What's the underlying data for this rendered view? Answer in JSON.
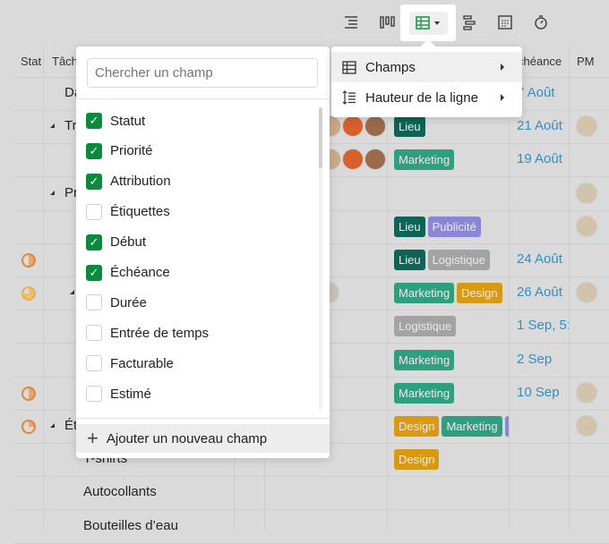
{
  "toolbar": {
    "icons": [
      "list-icon",
      "board-icon",
      "table-icon",
      "gantt-icon",
      "calendar-icon",
      "timer-icon"
    ],
    "active": "table-icon"
  },
  "table": {
    "headers": {
      "status": "Stat",
      "task": "Tâch",
      "due": "chéance",
      "pm": "PM"
    },
    "rows": [
      {
        "task": "Da",
        "due": "7 Août",
        "tags": []
      },
      {
        "task": "Tr",
        "due": "21 Août",
        "tags": [
          "Lieu"
        ],
        "caret": true,
        "pm": true,
        "assignees": true
      },
      {
        "task": "",
        "due": "19 Août",
        "tags": [
          "Marketing"
        ],
        "assignees": true
      },
      {
        "task": "Pr",
        "due": "",
        "tags": [],
        "caret": true,
        "pm": true
      },
      {
        "task": "",
        "due": "",
        "tags": [
          "Lieu",
          "Publicité"
        ],
        "pm": true
      },
      {
        "task": "",
        "due": "24 Août",
        "tags": [
          "Lieu",
          "Logistique"
        ],
        "status": "half"
      },
      {
        "task": "",
        "due": "26 Août",
        "tags": [
          "Marketing",
          "Design"
        ],
        "status": "quarter-yellow",
        "caret": true,
        "pm": true
      },
      {
        "task": "",
        "due": "1 Sep, 5:",
        "tags": [
          "Logistique"
        ]
      },
      {
        "task": "",
        "due": "2 Sep",
        "tags": [
          "Marketing"
        ]
      },
      {
        "task": "",
        "due": "10 Sep",
        "tags": [
          "Marketing"
        ],
        "status": "half",
        "pm": true
      },
      {
        "task": "Ét",
        "due": "",
        "tags": [
          "Design",
          "Marketing",
          "Publicité"
        ],
        "status": "quarter",
        "caret": true,
        "pm": true
      },
      {
        "task": "T-shirts",
        "due": "",
        "tags": [
          "Design"
        ]
      },
      {
        "task": "Autocollants",
        "due": "",
        "tags": []
      },
      {
        "task": "Bouteilles d’eau",
        "due": "",
        "tags": []
      }
    ],
    "tag_colors": {
      "Lieu": "#0d6456",
      "Marketing": "#2f9f80",
      "Design": "#d99a12",
      "Publicité": "#8c86d6",
      "Logistique": "#a3a3a3"
    }
  },
  "fields_panel": {
    "search_placeholder": "Chercher un champ",
    "fields": [
      {
        "label": "Statut",
        "checked": true
      },
      {
        "label": "Priorité",
        "checked": true
      },
      {
        "label": "Attribution",
        "checked": true
      },
      {
        "label": "Étiquettes",
        "checked": false
      },
      {
        "label": "Début",
        "checked": true
      },
      {
        "label": "Échéance",
        "checked": true
      },
      {
        "label": "Durée",
        "checked": false
      },
      {
        "label": "Entrée de temps",
        "checked": false
      },
      {
        "label": "Facturable",
        "checked": false
      },
      {
        "label": "Estimé",
        "checked": false
      }
    ],
    "add_label": "Ajouter un nouveau champ"
  },
  "view_menu": {
    "items": [
      {
        "label": "Champs",
        "icon": "table-icon"
      },
      {
        "label": "Hauteur de la ligne",
        "icon": "row-height-icon"
      }
    ]
  },
  "colors": {
    "accent": "#0a8a3c",
    "date": "#2f8fc7"
  }
}
